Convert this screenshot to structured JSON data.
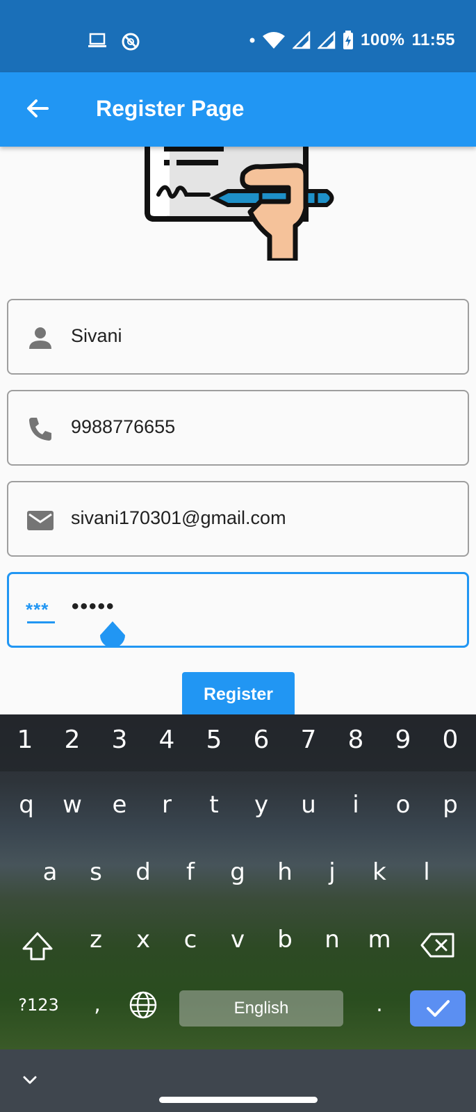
{
  "status_bar": {
    "battery": "100%",
    "time": "11:55",
    "icons": [
      "laptop-icon",
      "sync-off-icon",
      "dot-icon",
      "wifi-icon",
      "signal-icon",
      "signal-icon",
      "battery-charging-icon"
    ]
  },
  "app_bar": {
    "title": "Register Page",
    "back_icon": "arrow-back-icon"
  },
  "form": {
    "fields": [
      {
        "icon": "person-icon",
        "value": "Sivani"
      },
      {
        "icon": "phone-icon",
        "value": "9988776655"
      },
      {
        "icon": "email-icon",
        "value": "sivani170301@gmail.com"
      },
      {
        "icon": "password-icon",
        "icon_text": "***",
        "value": "•••••",
        "focused": true
      }
    ],
    "register_label": "Register"
  },
  "keyboard": {
    "numbers": [
      "1",
      "2",
      "3",
      "4",
      "5",
      "6",
      "7",
      "8",
      "9",
      "0"
    ],
    "row_q": [
      "q",
      "w",
      "e",
      "r",
      "t",
      "y",
      "u",
      "i",
      "o",
      "p"
    ],
    "row_a": [
      "a",
      "s",
      "d",
      "f",
      "g",
      "h",
      "j",
      "k",
      "l"
    ],
    "row_z": [
      "z",
      "x",
      "c",
      "v",
      "b",
      "n",
      "m"
    ],
    "symbols_label": "?123",
    "comma": ",",
    "space_label": "English",
    "period": "."
  },
  "colors": {
    "primary": "#2196f3",
    "status_bar": "#1a6fb8",
    "enter_key": "#5b8ff2"
  }
}
